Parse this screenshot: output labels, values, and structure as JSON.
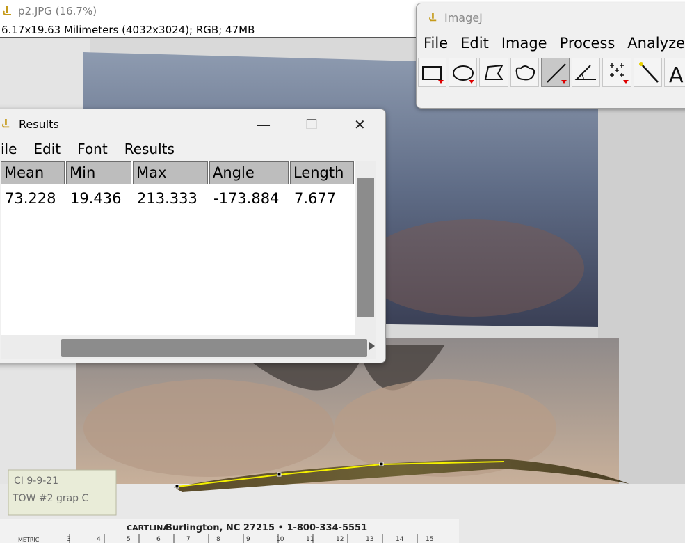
{
  "image_window": {
    "title": "p2.JPG (16.7%)",
    "info": "6.17x19.63 Milimeters (4032x3024); RGB; 47MB"
  },
  "photo": {
    "label_line1": "CI  9-9-21",
    "label_line2": "TOW #2  grap C",
    "ruler_brand": "CARTLINA",
    "ruler_text": "Burlington, NC 27215  •  1-800-334-5551",
    "ruler_metric": "METRIC",
    "ruler_numbers": [
      "3",
      "4",
      "5",
      "6",
      "7",
      "8",
      "9",
      "10",
      "11",
      "12",
      "13",
      "14",
      "15"
    ]
  },
  "imagej": {
    "title": "ImageJ",
    "menu": [
      "File",
      "Edit",
      "Image",
      "Process",
      "Analyze"
    ],
    "tools": [
      {
        "name": "rectangle-tool-icon",
        "selected": false
      },
      {
        "name": "oval-tool-icon",
        "selected": false
      },
      {
        "name": "polygon-tool-icon",
        "selected": false
      },
      {
        "name": "freehand-tool-icon",
        "selected": false
      },
      {
        "name": "line-tool-icon",
        "selected": true
      },
      {
        "name": "angle-tool-icon",
        "selected": false
      },
      {
        "name": "point-tool-icon",
        "selected": false
      },
      {
        "name": "wand-tool-icon",
        "selected": false
      },
      {
        "name": "text-tool-icon",
        "selected": false
      }
    ],
    "text_tool_glyph": "A"
  },
  "results": {
    "title": "Results",
    "menu": [
      "ile",
      "Edit",
      "Font",
      "Results"
    ],
    "columns": [
      "Mean",
      "Min",
      "Max",
      "Angle",
      "Length"
    ],
    "rows": [
      [
        "73.228",
        "19.436",
        "213.333",
        "-173.884",
        "7.677"
      ]
    ],
    "window_controls": {
      "minimize": "—",
      "maximize": "☐",
      "close": "✕"
    }
  },
  "colors": {
    "measure_line": "#f4f000",
    "tool_dropdown": "#dd0000"
  }
}
